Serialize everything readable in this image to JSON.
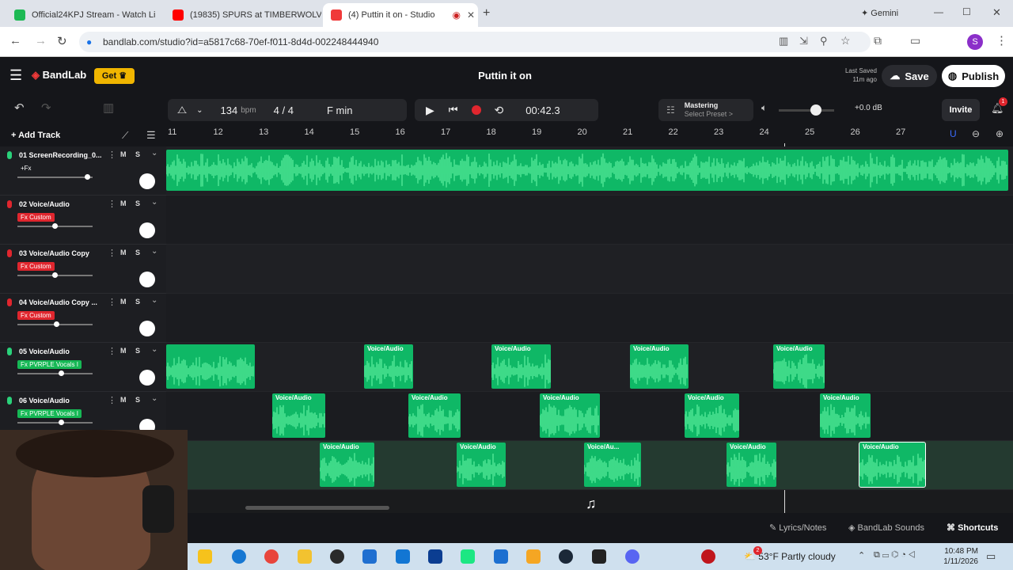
{
  "browser": {
    "tabs": [
      {
        "title": "Official24KPJ Stream - Watch Li",
        "color": "#1db954"
      },
      {
        "title": "(19835) SPURS at TIMBERWOLV",
        "color": "#ff0000"
      },
      {
        "title": "(4) Puttin it on - Studio",
        "color": "#f03a3a"
      }
    ],
    "gemini_label": "Gemini",
    "url": "bandlab.com/studio?id=a5817c68-70ef-f011-8d4d-002248444940",
    "profile_initial": "S"
  },
  "app": {
    "brand": "BandLab",
    "get_label": "Get",
    "project_title": "Puttin it on",
    "last_saved_label": "Last Saved",
    "last_saved_time": "11m ago",
    "save_label": "Save",
    "publish_label": "Publish",
    "invite_label": "Invite",
    "notification_count": "1",
    "bpm": "134",
    "bpm_unit": "bpm",
    "time_signature": "4 / 4",
    "key": "F min",
    "time": "00:42.3",
    "mastering_label": "Mastering",
    "mastering_sub": "Select Preset >",
    "volume_db": "+0.0 dB",
    "add_track_label": "Add Track",
    "ruler": [
      "11",
      "12",
      "13",
      "14",
      "15",
      "16",
      "17",
      "18",
      "19",
      "20",
      "21",
      "22",
      "23",
      "24",
      "25",
      "26",
      "27"
    ],
    "lyrics_label": "Lyrics/Notes",
    "sounds_label": "BandLab Sounds",
    "shortcuts_label": "Shortcuts"
  },
  "tracks": [
    {
      "name": "01  ScreenRecording_0...",
      "fx": "+Fx",
      "fx_color": "transparent",
      "mic": "#2ad17a"
    },
    {
      "name": "02  Voice/Audio",
      "fx": "Fx Custom",
      "fx_color": "#e0262e",
      "mic": "#e0262e"
    },
    {
      "name": "03  Voice/Audio Copy",
      "fx": "Fx Custom",
      "fx_color": "#e0262e",
      "mic": "#e0262e"
    },
    {
      "name": "04  Voice/Audio Copy ...",
      "fx": "Fx Custom",
      "fx_color": "#e0262e",
      "mic": "#e0262e"
    },
    {
      "name": "05  Voice/Audio",
      "fx": "Fx PVRPLE Vocals I",
      "fx_color": "#16b855",
      "mic": "#2ad17a"
    },
    {
      "name": "06  Voice/Audio",
      "fx": "Fx PVRPLE Vocals I",
      "fx_color": "#16b855",
      "mic": "#2ad17a"
    }
  ],
  "clip_label": "Voice/Audio",
  "clip_label_short": "Voice/Au...",
  "track_buttons": {
    "mute": "M",
    "solo": "S"
  },
  "taskbar": {
    "weather": "53°F  Partly cloudy",
    "weather_badge": "2",
    "time": "10:48 PM",
    "date": "1/11/2026"
  }
}
